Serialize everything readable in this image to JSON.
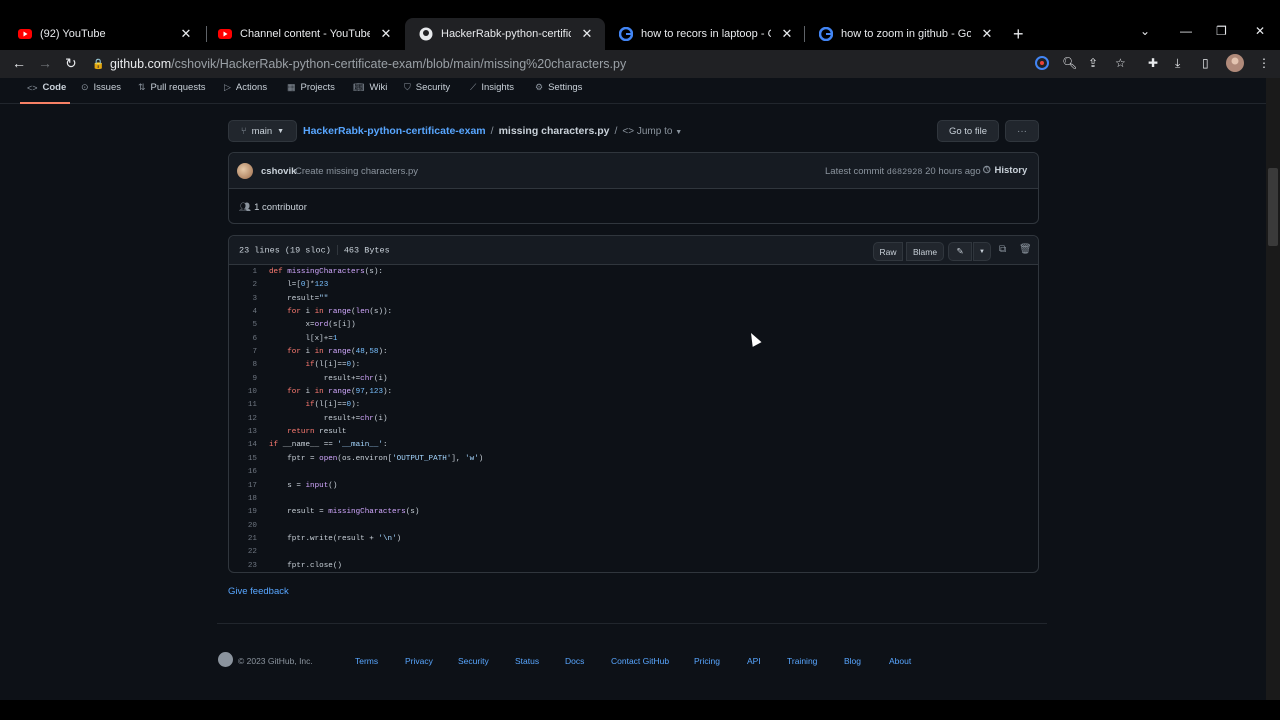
{
  "browser": {
    "tabs": [
      {
        "title": "(92) YouTube",
        "icon": "youtube-icon",
        "close": "✕"
      },
      {
        "title": "Channel content - YouTube Studio",
        "icon": "youtube-icon",
        "close": "✕"
      },
      {
        "title": "HackerRabk-python-certificate-e",
        "icon": "github-icon",
        "close": "✕"
      },
      {
        "title": "how to recors in laptoop - Goog",
        "icon": "google-icon",
        "close": "✕"
      },
      {
        "title": "how to zoom in github - Google",
        "icon": "google-icon",
        "close": "✕"
      }
    ],
    "new_tab": "+",
    "url_host": "github.com",
    "url_path": "/cshovik/HackerRabk-python-certificate-exam/blob/main/missing%20characters.py"
  },
  "repo_nav": {
    "items": [
      "Code",
      "Issues",
      "Pull requests",
      "Actions",
      "Projects",
      "Wiki",
      "Security",
      "Insights",
      "Settings"
    ]
  },
  "file_header": {
    "branch": "main",
    "repo": "HackerRabk-python-certificate-exam",
    "separator": "/",
    "file": "missing characters.py",
    "jump_to": "Jump to",
    "go_to_file": "Go to file",
    "more": "···"
  },
  "commit": {
    "author": "cshovik",
    "message": "Create missing characters.py",
    "latest_label": "Latest commit",
    "sha": "d682928",
    "time": "20 hours ago",
    "history": "History",
    "contributors": "1 contributor"
  },
  "code_header": {
    "lines": "23 lines (19 sloc)",
    "size": "463 Bytes",
    "raw": "Raw",
    "blame": "Blame"
  },
  "code_lines": [
    "def missingCharacters(s):",
    "    l=[0]*123",
    "    result=\"\"",
    "    for i in range(len(s)):",
    "        x=ord(s[i])",
    "        l[x]+=1",
    "    for i in range(48,58):",
    "        if(l[i]==0):",
    "            result+=chr(i)",
    "    for i in range(97,123):",
    "        if(l[i]==0):",
    "            result+=chr(i)",
    "    return result",
    "if __name__ == '__main__':",
    "    fptr = open(os.environ['OUTPUT_PATH'], 'w')",
    "",
    "    s = input()",
    "",
    "    result = missingCharacters(s)",
    "",
    "    fptr.write(result + '\\n')",
    "",
    "    fptr.close()"
  ],
  "feedback": "Give feedback",
  "footer": {
    "copyright": "© 2023 GitHub, Inc.",
    "links": [
      "Terms",
      "Privacy",
      "Security",
      "Status",
      "Docs",
      "Contact GitHub",
      "Pricing",
      "API",
      "Training",
      "Blog",
      "About"
    ]
  },
  "colors": {
    "background": "#0d1117",
    "link": "#58a6ff",
    "keyword": "#ff7b72",
    "function": "#d2a8ff",
    "string": "#a5d6ff",
    "active_tab_underline": "#f78166"
  }
}
